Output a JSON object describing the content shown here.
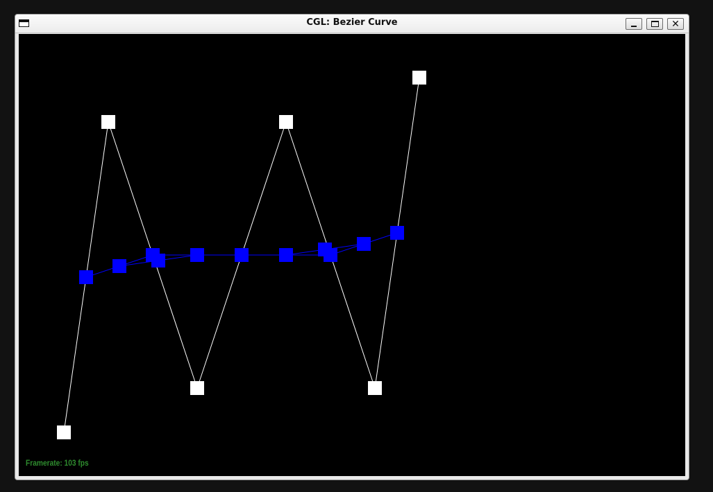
{
  "window": {
    "title": "CGL: Bezier Curve",
    "buttons": {
      "minimize": "minimize-icon",
      "maximize": "maximize-icon",
      "close": "close-icon"
    }
  },
  "colors": {
    "background": "#000000",
    "control_points": "#ffffff",
    "curve": "#0000ff",
    "framerate_text": "#2e8b2e"
  },
  "status": {
    "framerate": "Framerate: 103 fps"
  }
}
